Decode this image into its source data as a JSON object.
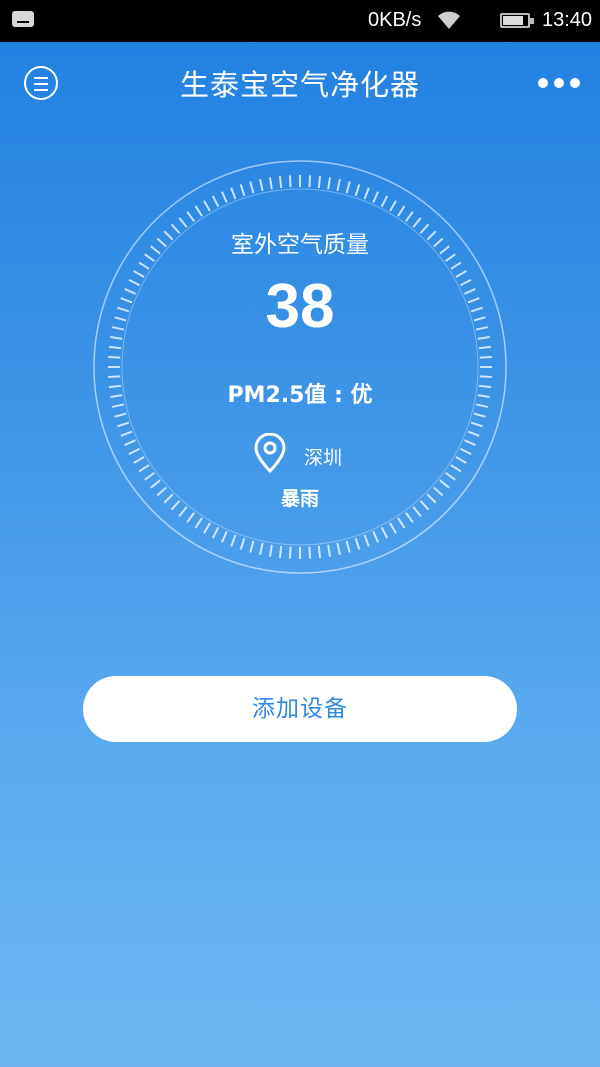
{
  "status_bar": {
    "net_speed": "0KB/s",
    "time": "13:40",
    "battery_level": 0.85,
    "icons": [
      "notification-icon",
      "wifi-icon",
      "battery-icon"
    ]
  },
  "header": {
    "title": "生泰宝空气净化器",
    "menu_icon": "menu-icon",
    "more_icon": "more-icon"
  },
  "air_quality": {
    "label": "室外空气质量",
    "value": "38",
    "pm25_text": "PM2.5值 : 优",
    "city": "深圳",
    "weather": "暴雨"
  },
  "actions": {
    "add_device_label": "添加设备"
  },
  "colors": {
    "background_top": "#1f7fe0",
    "background_bottom": "#6db6f3",
    "accent": "#2f8ae2"
  }
}
